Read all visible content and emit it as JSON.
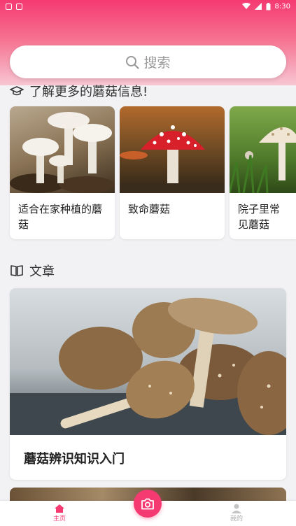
{
  "status_bar": {
    "time": "8:30"
  },
  "search": {
    "placeholder": "搜索"
  },
  "section_info": {
    "title": "了解更多的蘑菇信息!"
  },
  "cards": [
    {
      "label": "适合在家种植的蘑菇"
    },
    {
      "label": "致命蘑菇"
    },
    {
      "label": "院子里常见蘑菇"
    }
  ],
  "section_articles": {
    "title": "文章"
  },
  "articles": [
    {
      "title": "蘑菇辨识知识入门"
    }
  ],
  "bottom_nav": {
    "home_label": "主页",
    "profile_label": "我的"
  },
  "colors": {
    "accent": "#f53a72",
    "background": "#f2f1f3"
  },
  "icons": [
    "search-icon",
    "graduation-cap-icon",
    "book-icon",
    "camera-icon",
    "home-icon",
    "user-icon"
  ]
}
